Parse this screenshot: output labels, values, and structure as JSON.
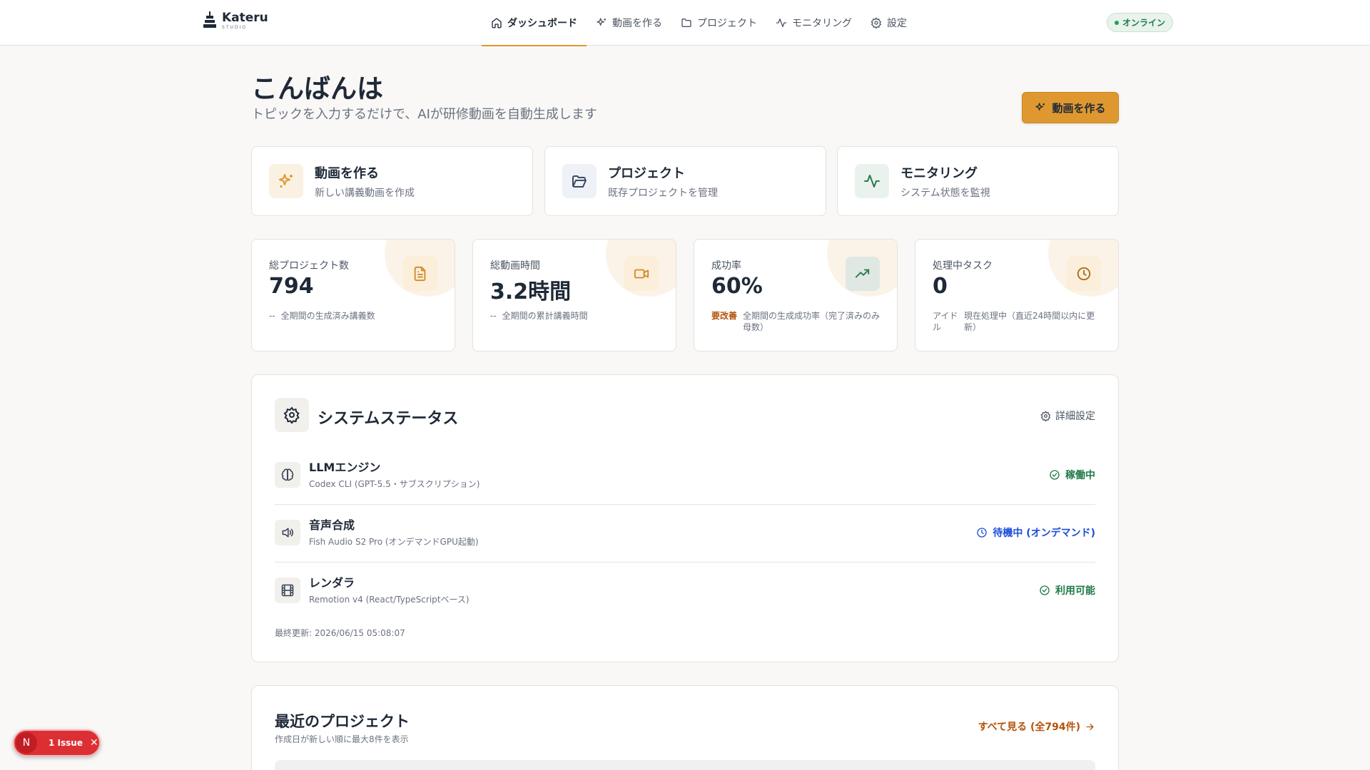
{
  "colors": {
    "accent": "#df982f",
    "success": "#1f7a47",
    "info": "#1d4ed8",
    "warning": "#b45309",
    "danger": "#dc2f34"
  },
  "brand": {
    "name": "Kateru",
    "sub": "STUDIO"
  },
  "nav": {
    "items": [
      {
        "label": "ダッシュボード",
        "icon": "home-icon",
        "active": true
      },
      {
        "label": "動画を作る",
        "icon": "sparkles-icon"
      },
      {
        "label": "プロジェクト",
        "icon": "folder-icon"
      },
      {
        "label": "モニタリング",
        "icon": "activity-icon"
      },
      {
        "label": "設定",
        "icon": "gear-icon"
      }
    ]
  },
  "status_badge": "オンライン",
  "header": {
    "greeting": "こんばんは",
    "subtitle": "トピックを入力するだけで、AIが研修動画を自動生成します",
    "create_button": "動画を作る"
  },
  "quick_actions": [
    {
      "title": "動画を作る",
      "desc": "新しい講義動画を作成",
      "icon": "sparkles-icon"
    },
    {
      "title": "プロジェクト",
      "desc": "既存プロジェクトを管理",
      "icon": "folder-open-icon"
    },
    {
      "title": "モニタリング",
      "desc": "システム状態を監視",
      "icon": "activity-icon"
    }
  ],
  "stats": [
    {
      "label": "総プロジェクト数",
      "value": "794",
      "tag": "--",
      "desc": "全期間の生成済み講義数",
      "icon": "document-icon"
    },
    {
      "label": "総動画時間",
      "value": "3.2時間",
      "tag": "--",
      "desc": "全期間の累計講義時間",
      "icon": "video-icon"
    },
    {
      "label": "成功率",
      "value": "60%",
      "tag": "要改善",
      "desc": "全期間の生成成功率（完了済みのみ母数）",
      "icon": "trending-up-icon"
    },
    {
      "label": "処理中タスク",
      "value": "0",
      "tag": "アイドル",
      "desc": "現在処理中（直近24時間以内に更新）",
      "icon": "clock-icon"
    }
  ],
  "system_status": {
    "title": "システムステータス",
    "detail_link": "詳細設定",
    "services": [
      {
        "name": "LLMエンジン",
        "desc": "Codex CLI (GPT-5.5・サブスクリプション)",
        "status": "稼働中",
        "icon": "brain-icon"
      },
      {
        "name": "音声合成",
        "desc": "Fish Audio S2 Pro (オンデマンドGPU起動)",
        "status": "待機中 (オンデマンド)",
        "icon": "speaker-icon"
      },
      {
        "name": "レンダラ",
        "desc": "Remotion v4 (React/TypeScriptベース)",
        "status": "利用可能",
        "icon": "film-icon"
      }
    ],
    "last_updated": "最終更新: 2026/06/15 05:08:07"
  },
  "recent": {
    "title": "最近のプロジェクト",
    "subtitle": "作成日が新しい順に最大8件を表示",
    "see_all": "すべて見る (全794件)"
  },
  "issue_badge": {
    "letter": "N",
    "text": "1 Issue",
    "close": "✕"
  }
}
